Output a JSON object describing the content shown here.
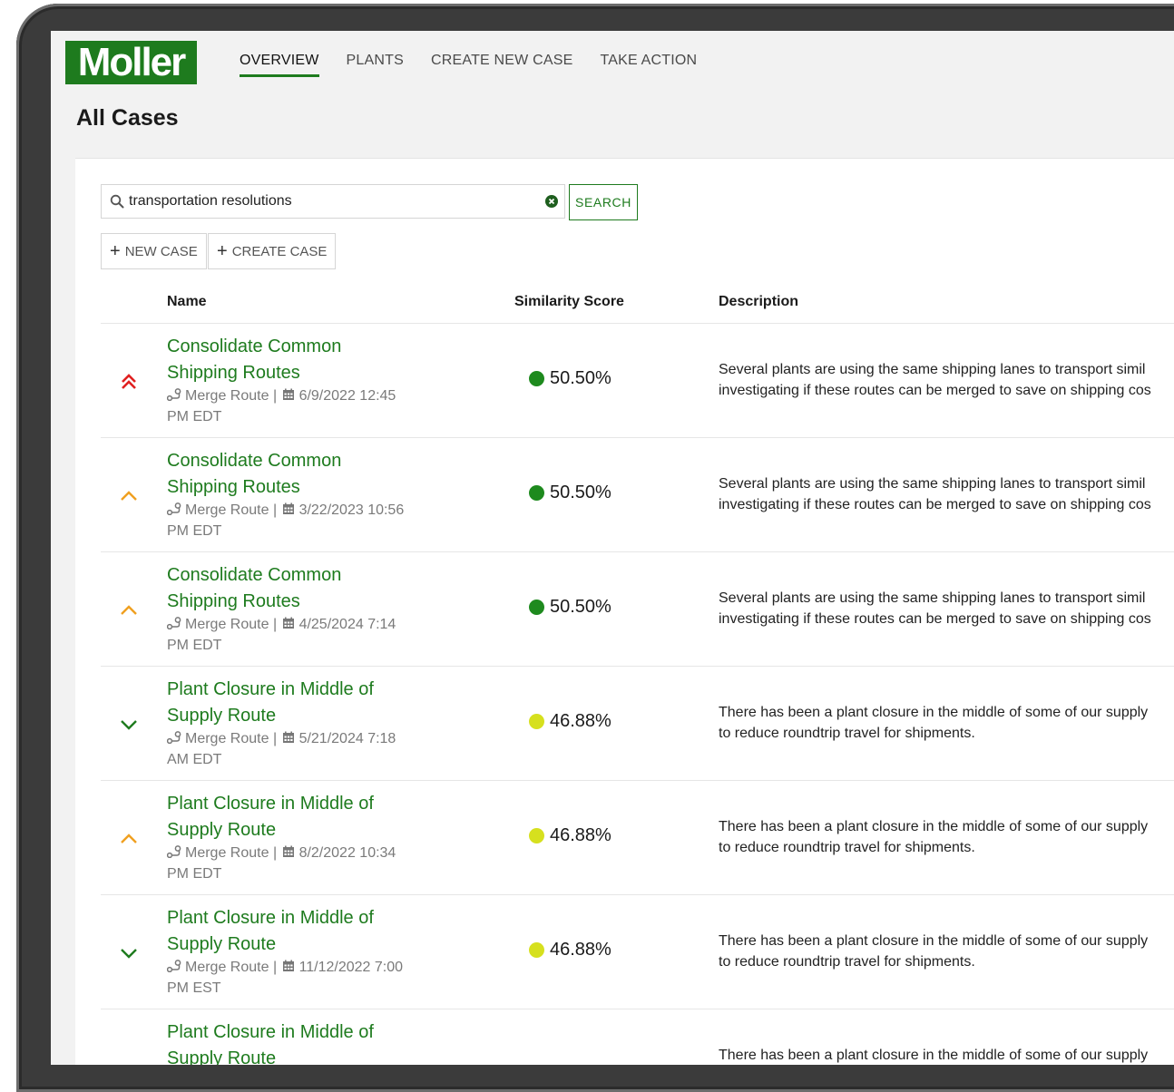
{
  "brand": {
    "logo_text": "Moller",
    "color": "#1e7b1e"
  },
  "nav": {
    "items": [
      {
        "label": "OVERVIEW",
        "active": true
      },
      {
        "label": "PLANTS",
        "active": false
      },
      {
        "label": "CREATE NEW CASE",
        "active": false
      },
      {
        "label": "TAKE ACTION",
        "active": false
      }
    ]
  },
  "page": {
    "title": "All Cases"
  },
  "search": {
    "value": "transportation resolutions",
    "button_label": "SEARCH",
    "search_icon": "search-icon",
    "clear_icon": "clear-circle-icon"
  },
  "actions": {
    "new_case_label": "NEW CASE",
    "create_case_label": "CREATE CASE"
  },
  "table": {
    "headers": {
      "name": "Name",
      "score": "Similarity Score",
      "description": "Description"
    },
    "rows": [
      {
        "priority": "critical",
        "priority_icon": "double-chevron-up-icon",
        "priority_color": "#e02020",
        "title_line1": "Consolidate Common",
        "title_line2": "Shipping Routes",
        "type": "Merge Route",
        "datetime_line1": "6/9/2022 12:45",
        "datetime_line2": "PM EDT",
        "score": "50.50%",
        "score_color": "#1e8a1e",
        "desc_line1": "Several plants are using the same shipping lanes to transport simil",
        "desc_line2": "investigating if these routes can be merged to save on shipping cos"
      },
      {
        "priority": "high",
        "priority_icon": "chevron-up-icon",
        "priority_color": "#f0a020",
        "title_line1": "Consolidate Common",
        "title_line2": "Shipping Routes",
        "type": "Merge Route",
        "datetime_line1": "3/22/2023 10:56",
        "datetime_line2": "PM EDT",
        "score": "50.50%",
        "score_color": "#1e8a1e",
        "desc_line1": "Several plants are using the same shipping lanes to transport simil",
        "desc_line2": "investigating if these routes can be merged to save on shipping cos"
      },
      {
        "priority": "high",
        "priority_icon": "chevron-up-icon",
        "priority_color": "#f0a020",
        "title_line1": "Consolidate Common",
        "title_line2": "Shipping Routes",
        "type": "Merge Route",
        "datetime_line1": "4/25/2024 7:14",
        "datetime_line2": "PM EDT",
        "score": "50.50%",
        "score_color": "#1e8a1e",
        "desc_line1": "Several plants are using the same shipping lanes to transport simil",
        "desc_line2": "investigating if these routes can be merged to save on shipping cos"
      },
      {
        "priority": "low",
        "priority_icon": "chevron-down-icon",
        "priority_color": "#1e7b1e",
        "title_line1": "Plant Closure in Middle of",
        "title_line2": "Supply Route",
        "type": "Merge Route",
        "datetime_line1": "5/21/2024 7:18",
        "datetime_line2": "AM EDT",
        "score": "46.88%",
        "score_color": "#d6e01e",
        "desc_line1": "There has been a plant closure in the middle of some of our supply",
        "desc_line2": "to reduce roundtrip travel for shipments."
      },
      {
        "priority": "high",
        "priority_icon": "chevron-up-icon",
        "priority_color": "#f0a020",
        "title_line1": "Plant Closure in Middle of",
        "title_line2": "Supply Route",
        "type": "Merge Route",
        "datetime_line1": "8/2/2022 10:34",
        "datetime_line2": "PM EDT",
        "score": "46.88%",
        "score_color": "#d6e01e",
        "desc_line1": "There has been a plant closure in the middle of some of our supply",
        "desc_line2": "to reduce roundtrip travel for shipments."
      },
      {
        "priority": "low",
        "priority_icon": "chevron-down-icon",
        "priority_color": "#1e7b1e",
        "title_line1": "Plant Closure in Middle of",
        "title_line2": "Supply Route",
        "type": "Merge Route",
        "datetime_line1": "11/12/2022 7:00",
        "datetime_line2": "PM EST",
        "score": "46.88%",
        "score_color": "#d6e01e",
        "desc_line1": "There has been a plant closure in the middle of some of our supply",
        "desc_line2": "to reduce roundtrip travel for shipments."
      },
      {
        "priority": "",
        "priority_icon": "",
        "priority_color": "",
        "title_line1": "Plant Closure in Middle of",
        "title_line2": "Supply Route",
        "type": "",
        "datetime_line1": "",
        "datetime_line2": "",
        "score": "",
        "score_color": "",
        "desc_line1": "There has been a plant closure in the middle of some of our supply",
        "desc_line2": ""
      }
    ]
  }
}
